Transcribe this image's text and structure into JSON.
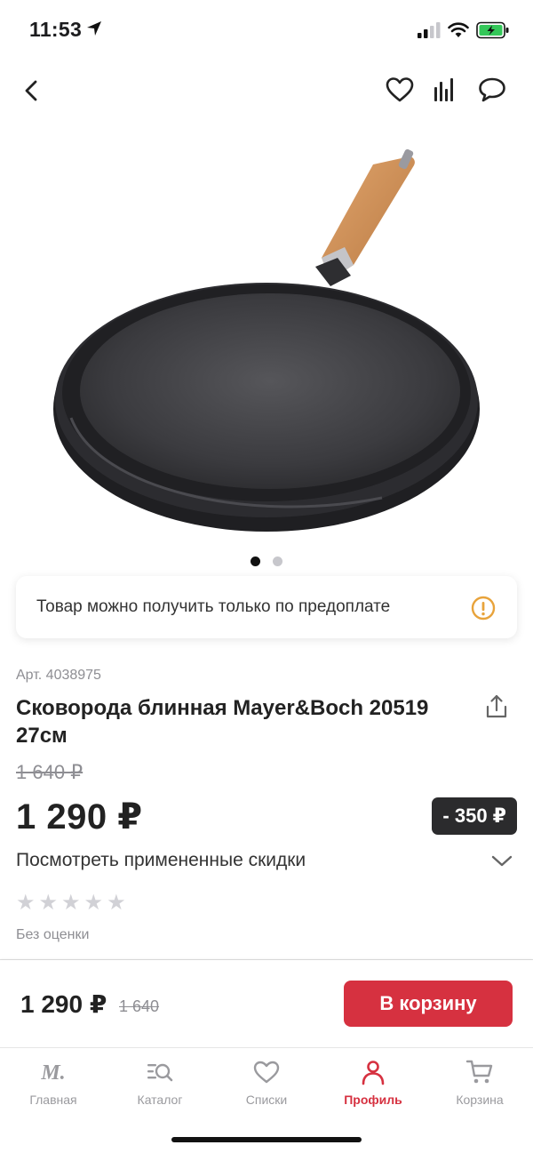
{
  "status": {
    "time": "11:53"
  },
  "header": {
    "icons": [
      "back-icon",
      "heart-icon",
      "compare-icon",
      "chat-icon"
    ]
  },
  "gallery": {
    "image": "cast-iron-pancake-pan",
    "slides_count": 2,
    "active_slide": 1
  },
  "notice": {
    "text": "Товар можно получить только по предоплате",
    "icon": "warning-icon",
    "icon_color": "#e8a33b"
  },
  "product": {
    "sku": "Арт. 4038975",
    "title": "Сковорода блинная Mayer&Boch 20519 27см",
    "old_price": "1 640 ₽",
    "price": "1 290 ₽",
    "discount": "- 350 ₽",
    "discounts_link": "Посмотреть примененные скидки",
    "rating_stars": 0,
    "rating_max": 5,
    "rating_text": "Без оценки"
  },
  "buy_bar": {
    "price": "1 290 ₽",
    "old_price": "1 640",
    "cart_button": "В корзину",
    "accent_color": "#d63140"
  },
  "tabbar": {
    "tabs": [
      {
        "label": "Главная",
        "icon": "logo-m-icon",
        "active": false
      },
      {
        "label": "Каталог",
        "icon": "catalog-search-icon",
        "active": false
      },
      {
        "label": "Списки",
        "icon": "heart-icon",
        "active": false
      },
      {
        "label": "Профиль",
        "icon": "profile-icon",
        "active": true
      },
      {
        "label": "Корзина",
        "icon": "cart-icon",
        "active": false
      }
    ]
  }
}
